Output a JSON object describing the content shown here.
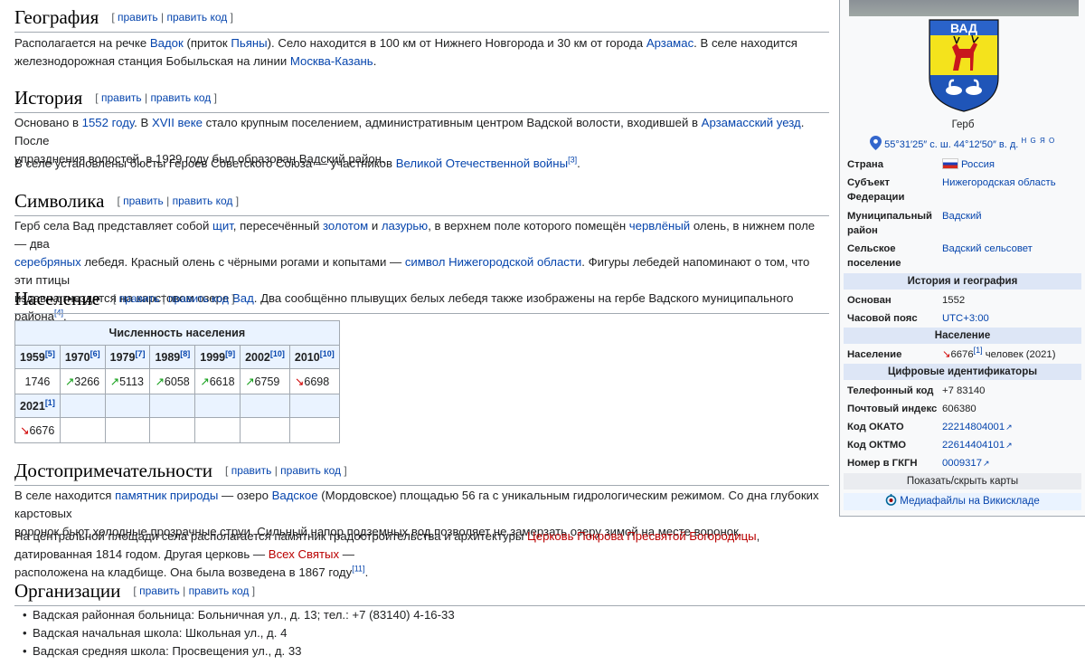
{
  "sections": {
    "edit": "править",
    "edit_code": "править код",
    "geography": {
      "title": "География",
      "p1_a": "Располагается на речке ",
      "link_vadok": "Вадок",
      "p1_b": " (приток ",
      "link_pyana": "Пьяны",
      "p1_c": "). Село находится в 100 км от Нижнего Новгорода и 30 км от города ",
      "link_arzamas": "Арзамас",
      "p1_d": ". В селе находится",
      "p1_e": "железнодорожная станция Бобыльская на линии ",
      "link_line": "Москва-Казань",
      "p1_f": "."
    },
    "history": {
      "title": "История",
      "p1_a": "Основано в ",
      "link_1552": "1552 году",
      "p1_b": ". В ",
      "link_xvii": "XVII веке",
      "p1_c": " стало крупным поселением, административным центром Вадской волости, входившей в ",
      "link_uezd": "Арзамасский уезд",
      "p1_d": ". После",
      "p1_e": "упразднения волостей, в 1929 году был образован Вадский район.",
      "p2_a": "В селе установлены бюсты Героев Советского Союза — участников ",
      "link_war": "Великой Отечественной войны",
      "ref3": "[3]",
      "p2_b": "."
    },
    "symbolics": {
      "title": "Символика",
      "a": "Герб села Вад представляет собой ",
      "l1": "щит",
      "b": ", пересечённый ",
      "l2": "золотом",
      "c": " и ",
      "l3": "лазурью",
      "d": ", в верхнем поле которого помещён ",
      "l4": "червлёный",
      "e": " олень, в нижнем поле — два",
      "l5": "серебряных",
      "f": " лебедя. Красный олень с чёрными рогами и копытами — ",
      "l6": "символ Нижегородской области",
      "g": ". Фигуры лебедей напоминают о том, что эти птицы",
      "h": "издавна гнездятся на карстовом озере ",
      "l7": "Вад",
      "i": ". Два сообщённо плывущих белых лебедя также изображены на гербе Вадского муниципального района",
      "ref4": "[4]",
      "j": "."
    },
    "population": {
      "title": "Население",
      "table_caption": "Численность населения",
      "years_row1": [
        {
          "year": "1959",
          "ref": "[5]"
        },
        {
          "year": "1970",
          "ref": "[6]"
        },
        {
          "year": "1979",
          "ref": "[7]"
        },
        {
          "year": "1989",
          "ref": "[8]"
        },
        {
          "year": "1999",
          "ref": "[9]"
        },
        {
          "year": "2002",
          "ref": "[10]"
        },
        {
          "year": "2010",
          "ref": "[10]"
        }
      ],
      "values_row1": [
        {
          "arrow": "",
          "value": "1746"
        },
        {
          "arrow": "↗",
          "value": "3266"
        },
        {
          "arrow": "↗",
          "value": "5113"
        },
        {
          "arrow": "↗",
          "value": "6058"
        },
        {
          "arrow": "↗",
          "value": "6618"
        },
        {
          "arrow": "↗",
          "value": "6759"
        },
        {
          "arrow": "↘",
          "value": "6698"
        }
      ],
      "years_row2": [
        {
          "year": "2021",
          "ref": "[1]"
        }
      ],
      "values_row2": [
        {
          "arrow": "↘",
          "value": "6676"
        }
      ]
    },
    "sights": {
      "title": "Достопримечательности",
      "p1_a": "В селе находится ",
      "l1": "памятник природы",
      "p1_b": " — озеро ",
      "l2": "Вадское",
      "p1_c": " (Мордовское) площадью 56 га с уникальным гидрологическим режимом. Со дна глубоких карстовых",
      "p1_d": "воронок бьют холодные прозрачные струи. Сильный напор подземных вод позволяет не замерзать озеру зимой на месте воронок.",
      "p2_a": "На центральной площади села располагается памятник градостроительства и архитектуры ",
      "l3": "Церковь Покрова Пресвятой Богородицы",
      "p2_b": ", датированная 1814 годом. Другая церковь — ",
      "l4": "Всех Святых",
      "p2_c": " —",
      "p2_d": "расположена на кладбище. Она была возведена в 1867 году",
      "ref11": "[11]",
      "p2_e": "."
    },
    "organizations": {
      "title": "Организации",
      "items": [
        "Вадская районная больница: Больничная ул., д. 13; тел.: +7 (83140) 4-16-33",
        "Вадская начальная школа: Школьная ул., д. 4",
        "Вадская средняя школа: Просвещения ул., д. 33"
      ]
    }
  },
  "infobox": {
    "coat_caption": "Герб",
    "coat_text": "ВАД",
    "coords": "55°31′25″ с. ш. 44°12′50″ в. д.",
    "coord_links": "H G Я O",
    "rows": [
      {
        "label": "Страна",
        "value": "Россия",
        "link": true
      },
      {
        "label": "Субъект Федерации",
        "value": "Нижегородская область",
        "link": true
      },
      {
        "label": "Муниципальный район",
        "value": "Вадский",
        "link": true
      },
      {
        "label": "Сельское поселение",
        "value": "Вадский сельсовет",
        "link": true
      }
    ],
    "head_history": "История и география",
    "founded_label": "Основан",
    "founded_value": "1552",
    "tz_label": "Часовой пояс",
    "tz_value": "UTC+3:00",
    "head_population": "Население",
    "pop_label": "Население",
    "pop_arrow": "↘",
    "pop_value": "6676",
    "pop_ref": "[1]",
    "pop_suffix": " человек (2021)",
    "head_ids": "Цифровые идентификаторы",
    "phone_label": "Телефонный код",
    "phone_value": "+7 83140",
    "postal_label": "Почтовый индекс",
    "postal_value": "606380",
    "okato_label": "Код ОКАТО",
    "okato_value": "22214804001",
    "oktmo_label": "Код ОКТМО",
    "oktmo_value": "22614404101",
    "gkgn_label": "Номер в ГКГН",
    "gkgn_value": "0009317",
    "toggle_maps": "Показать/скрыть карты",
    "commons": "Медиафайлы на Викискладе"
  }
}
